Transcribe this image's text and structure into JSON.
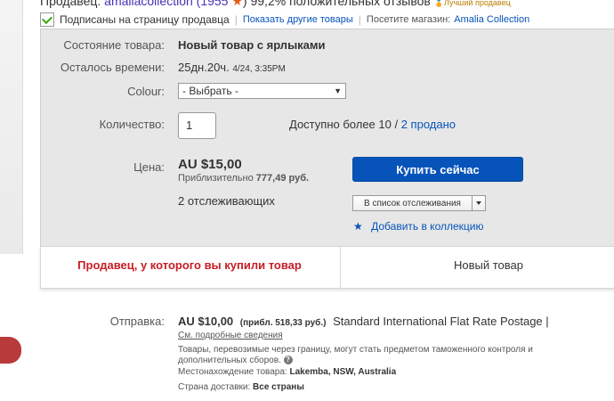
{
  "seller_top": {
    "label": "Продавец:",
    "name": "amaliacollection",
    "score": "(1955",
    "star_icon": "star-icon",
    "score_close": ")",
    "feedback": "99,2% положительных отзывов",
    "badge": "Лучший продавец"
  },
  "subscribe": {
    "checkbox_label": "Подписаны на страницу продавца",
    "other_items_link": "Показать другие товары",
    "visit_store_label": "Посетите магазин:",
    "store_link": "Amalia Collection"
  },
  "item": {
    "condition_label": "Состояние товара:",
    "condition_value": "Новый товар с ярлыками",
    "time_left_label": "Осталось времени:",
    "time_left_value": "25дн.20ч.",
    "time_left_date": "4/24, 3:35PM",
    "colour_label": "Colour:",
    "colour_selected": "- Выбрать -",
    "quantity_label": "Количество:",
    "quantity_value": "1",
    "available_text": "Доступно более 10 /",
    "sold_link": "2 продано",
    "price_label": "Цена:",
    "price_value": "AU $15,00",
    "approx_label": "Приблизительно",
    "approx_value": "777,49 руб.",
    "watchers": "2 отслеживающих",
    "buy_button": "Купить сейчас",
    "watchlist_button": "В список отслеживания",
    "add_collection_link": "Добавить в коллекцию"
  },
  "tabs": {
    "seller_bought": "Продавец, у которого вы купили товар",
    "new_item": "Новый товар"
  },
  "shipping": {
    "label": "Отправка:",
    "cost": "AU $10,00",
    "approx": "(прибл. 518,33 руб.)",
    "service": "Standard International Flat Rate Postage |",
    "details_link": "См. подробные сведения",
    "customs_note_1": "Товары, перевозимые через границу, могут стать предметом таможенного контроля и",
    "customs_note_2": "дополнительных сборов.",
    "location_label": "Местонахождение товара:",
    "location_value": "Lakemba, NSW, Australia",
    "country_label": "Страна доставки:",
    "country_value": "Все страны"
  },
  "colors": {
    "primary_button": "#0654ba",
    "link": "#0654ba",
    "seller_tab_red": "#c81d25",
    "panel_gray": "#e7e7e7"
  }
}
